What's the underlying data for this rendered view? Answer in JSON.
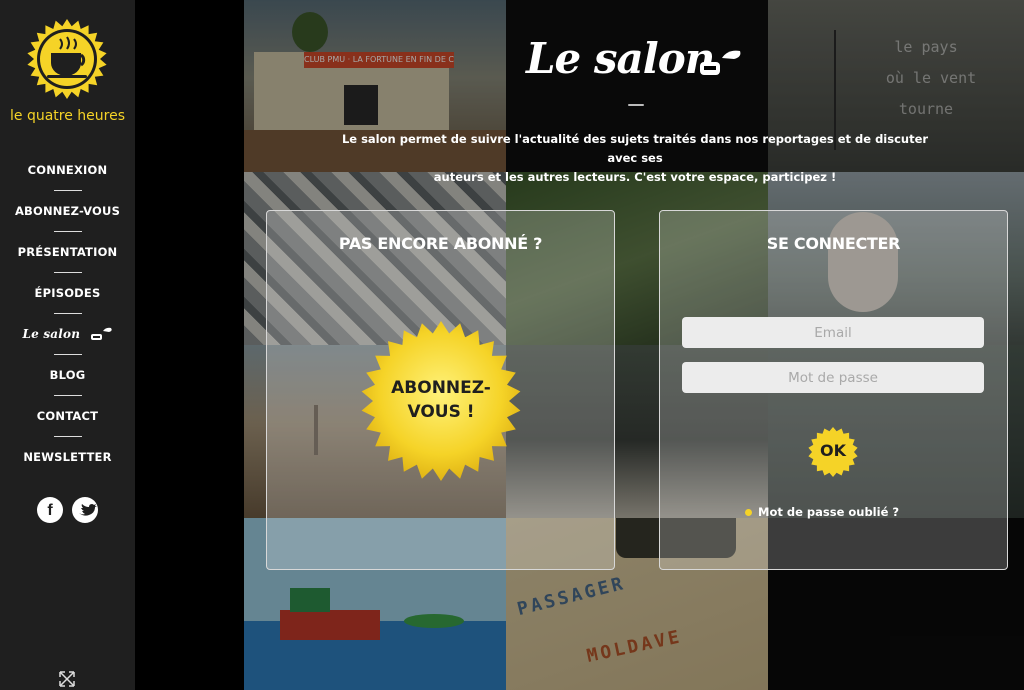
{
  "brand": {
    "name": "le quatre heures",
    "accent": "#f5d327"
  },
  "nav": {
    "items": [
      "CONNEXION",
      "ABONNEZ-VOUS",
      "PRÉSENTATION",
      "ÉPISODES",
      "Le salon",
      "BLOG",
      "CONTACT",
      "NEWSLETTER"
    ]
  },
  "social": {
    "facebook_glyph": "f",
    "icons": [
      "facebook-icon",
      "twitter-icon"
    ]
  },
  "header": {
    "title": "Le salon",
    "description_line1": "Le salon permet de suivre l'actualité des sujets traités dans nos reportages et de discuter avec ses",
    "description_line2": "auteurs et les autres lecteurs. C'est votre espace, participez !"
  },
  "background": {
    "tile_text": [
      "le pays",
      "où le vent",
      "tourne"
    ],
    "sign_text": "CLUB PMU · LA FORTUNE EN FIN DE COURSE",
    "map_words": [
      "PASSAGER",
      "MOLDAVE"
    ]
  },
  "subscribe_panel": {
    "title": "PAS ENCORE ABONNÉ ?",
    "cta_line1": "ABONNEZ-",
    "cta_line2": "VOUS !"
  },
  "login_panel": {
    "title": "SE CONNECTER",
    "email_placeholder": "Email",
    "password_placeholder": "Mot de passe",
    "submit_label": "OK",
    "forgot_label": "Mot de passe oublié ?"
  }
}
